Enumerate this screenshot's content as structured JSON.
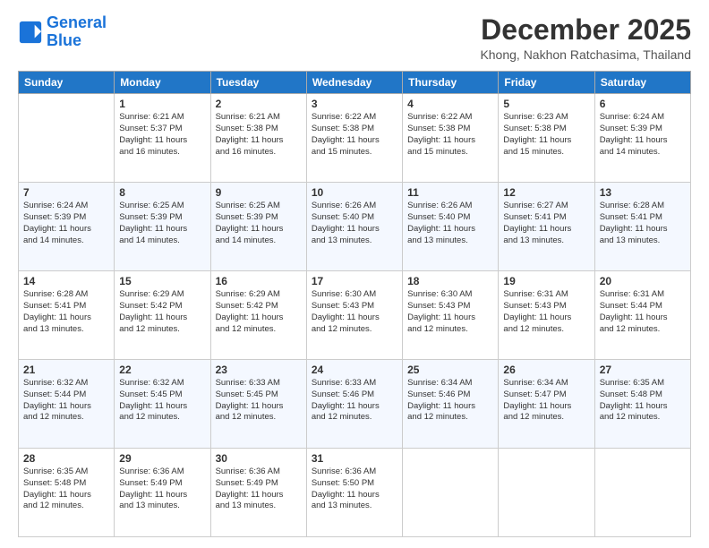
{
  "header": {
    "logo_line1": "General",
    "logo_line2": "Blue",
    "month_title": "December 2025",
    "location": "Khong, Nakhon Ratchasima, Thailand"
  },
  "weekdays": [
    "Sunday",
    "Monday",
    "Tuesday",
    "Wednesday",
    "Thursday",
    "Friday",
    "Saturday"
  ],
  "weeks": [
    [
      {
        "day": "",
        "info": ""
      },
      {
        "day": "1",
        "info": "Sunrise: 6:21 AM\nSunset: 5:37 PM\nDaylight: 11 hours\nand 16 minutes."
      },
      {
        "day": "2",
        "info": "Sunrise: 6:21 AM\nSunset: 5:38 PM\nDaylight: 11 hours\nand 16 minutes."
      },
      {
        "day": "3",
        "info": "Sunrise: 6:22 AM\nSunset: 5:38 PM\nDaylight: 11 hours\nand 15 minutes."
      },
      {
        "day": "4",
        "info": "Sunrise: 6:22 AM\nSunset: 5:38 PM\nDaylight: 11 hours\nand 15 minutes."
      },
      {
        "day": "5",
        "info": "Sunrise: 6:23 AM\nSunset: 5:38 PM\nDaylight: 11 hours\nand 15 minutes."
      },
      {
        "day": "6",
        "info": "Sunrise: 6:24 AM\nSunset: 5:39 PM\nDaylight: 11 hours\nand 14 minutes."
      }
    ],
    [
      {
        "day": "7",
        "info": "Sunrise: 6:24 AM\nSunset: 5:39 PM\nDaylight: 11 hours\nand 14 minutes."
      },
      {
        "day": "8",
        "info": "Sunrise: 6:25 AM\nSunset: 5:39 PM\nDaylight: 11 hours\nand 14 minutes."
      },
      {
        "day": "9",
        "info": "Sunrise: 6:25 AM\nSunset: 5:39 PM\nDaylight: 11 hours\nand 14 minutes."
      },
      {
        "day": "10",
        "info": "Sunrise: 6:26 AM\nSunset: 5:40 PM\nDaylight: 11 hours\nand 13 minutes."
      },
      {
        "day": "11",
        "info": "Sunrise: 6:26 AM\nSunset: 5:40 PM\nDaylight: 11 hours\nand 13 minutes."
      },
      {
        "day": "12",
        "info": "Sunrise: 6:27 AM\nSunset: 5:41 PM\nDaylight: 11 hours\nand 13 minutes."
      },
      {
        "day": "13",
        "info": "Sunrise: 6:28 AM\nSunset: 5:41 PM\nDaylight: 11 hours\nand 13 minutes."
      }
    ],
    [
      {
        "day": "14",
        "info": "Sunrise: 6:28 AM\nSunset: 5:41 PM\nDaylight: 11 hours\nand 13 minutes."
      },
      {
        "day": "15",
        "info": "Sunrise: 6:29 AM\nSunset: 5:42 PM\nDaylight: 11 hours\nand 12 minutes."
      },
      {
        "day": "16",
        "info": "Sunrise: 6:29 AM\nSunset: 5:42 PM\nDaylight: 11 hours\nand 12 minutes."
      },
      {
        "day": "17",
        "info": "Sunrise: 6:30 AM\nSunset: 5:43 PM\nDaylight: 11 hours\nand 12 minutes."
      },
      {
        "day": "18",
        "info": "Sunrise: 6:30 AM\nSunset: 5:43 PM\nDaylight: 11 hours\nand 12 minutes."
      },
      {
        "day": "19",
        "info": "Sunrise: 6:31 AM\nSunset: 5:43 PM\nDaylight: 11 hours\nand 12 minutes."
      },
      {
        "day": "20",
        "info": "Sunrise: 6:31 AM\nSunset: 5:44 PM\nDaylight: 11 hours\nand 12 minutes."
      }
    ],
    [
      {
        "day": "21",
        "info": "Sunrise: 6:32 AM\nSunset: 5:44 PM\nDaylight: 11 hours\nand 12 minutes."
      },
      {
        "day": "22",
        "info": "Sunrise: 6:32 AM\nSunset: 5:45 PM\nDaylight: 11 hours\nand 12 minutes."
      },
      {
        "day": "23",
        "info": "Sunrise: 6:33 AM\nSunset: 5:45 PM\nDaylight: 11 hours\nand 12 minutes."
      },
      {
        "day": "24",
        "info": "Sunrise: 6:33 AM\nSunset: 5:46 PM\nDaylight: 11 hours\nand 12 minutes."
      },
      {
        "day": "25",
        "info": "Sunrise: 6:34 AM\nSunset: 5:46 PM\nDaylight: 11 hours\nand 12 minutes."
      },
      {
        "day": "26",
        "info": "Sunrise: 6:34 AM\nSunset: 5:47 PM\nDaylight: 11 hours\nand 12 minutes."
      },
      {
        "day": "27",
        "info": "Sunrise: 6:35 AM\nSunset: 5:48 PM\nDaylight: 11 hours\nand 12 minutes."
      }
    ],
    [
      {
        "day": "28",
        "info": "Sunrise: 6:35 AM\nSunset: 5:48 PM\nDaylight: 11 hours\nand 12 minutes."
      },
      {
        "day": "29",
        "info": "Sunrise: 6:36 AM\nSunset: 5:49 PM\nDaylight: 11 hours\nand 13 minutes."
      },
      {
        "day": "30",
        "info": "Sunrise: 6:36 AM\nSunset: 5:49 PM\nDaylight: 11 hours\nand 13 minutes."
      },
      {
        "day": "31",
        "info": "Sunrise: 6:36 AM\nSunset: 5:50 PM\nDaylight: 11 hours\nand 13 minutes."
      },
      {
        "day": "",
        "info": ""
      },
      {
        "day": "",
        "info": ""
      },
      {
        "day": "",
        "info": ""
      }
    ]
  ]
}
